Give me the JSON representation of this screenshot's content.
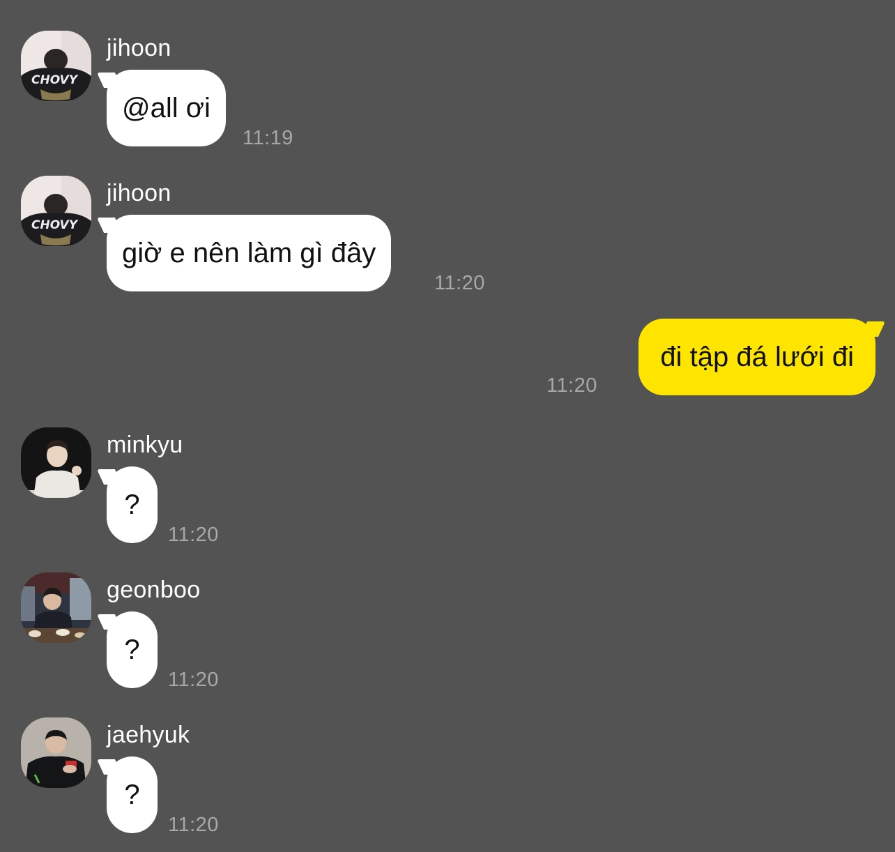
{
  "messages": [
    {
      "sender": "jihoon",
      "text": "@all ơi",
      "time": "11:19",
      "avatar_icon": "avatar-jihoon"
    },
    {
      "sender": "jihoon",
      "text": "giờ e nên làm gì đây",
      "time": "11:20",
      "avatar_icon": "avatar-jihoon"
    },
    {
      "sender": "",
      "text": "đi tập đá lưới đi",
      "time": "11:20",
      "outgoing": true
    },
    {
      "sender": "minkyu",
      "text": "?",
      "time": "11:20",
      "avatar_icon": "avatar-minkyu"
    },
    {
      "sender": "geonboo",
      "text": "?",
      "time": "11:20",
      "avatar_icon": "avatar-geonboo"
    },
    {
      "sender": "jaehyuk",
      "text": "?",
      "time": "11:20",
      "avatar_icon": "avatar-jaehyuk"
    }
  ],
  "avatar_shirt_text": "CHOVY",
  "colors": {
    "background": "#545354",
    "incoming_bubble": "#ffffff",
    "outgoing_bubble": "#fee500",
    "timestamp": "#a9a8a9"
  }
}
